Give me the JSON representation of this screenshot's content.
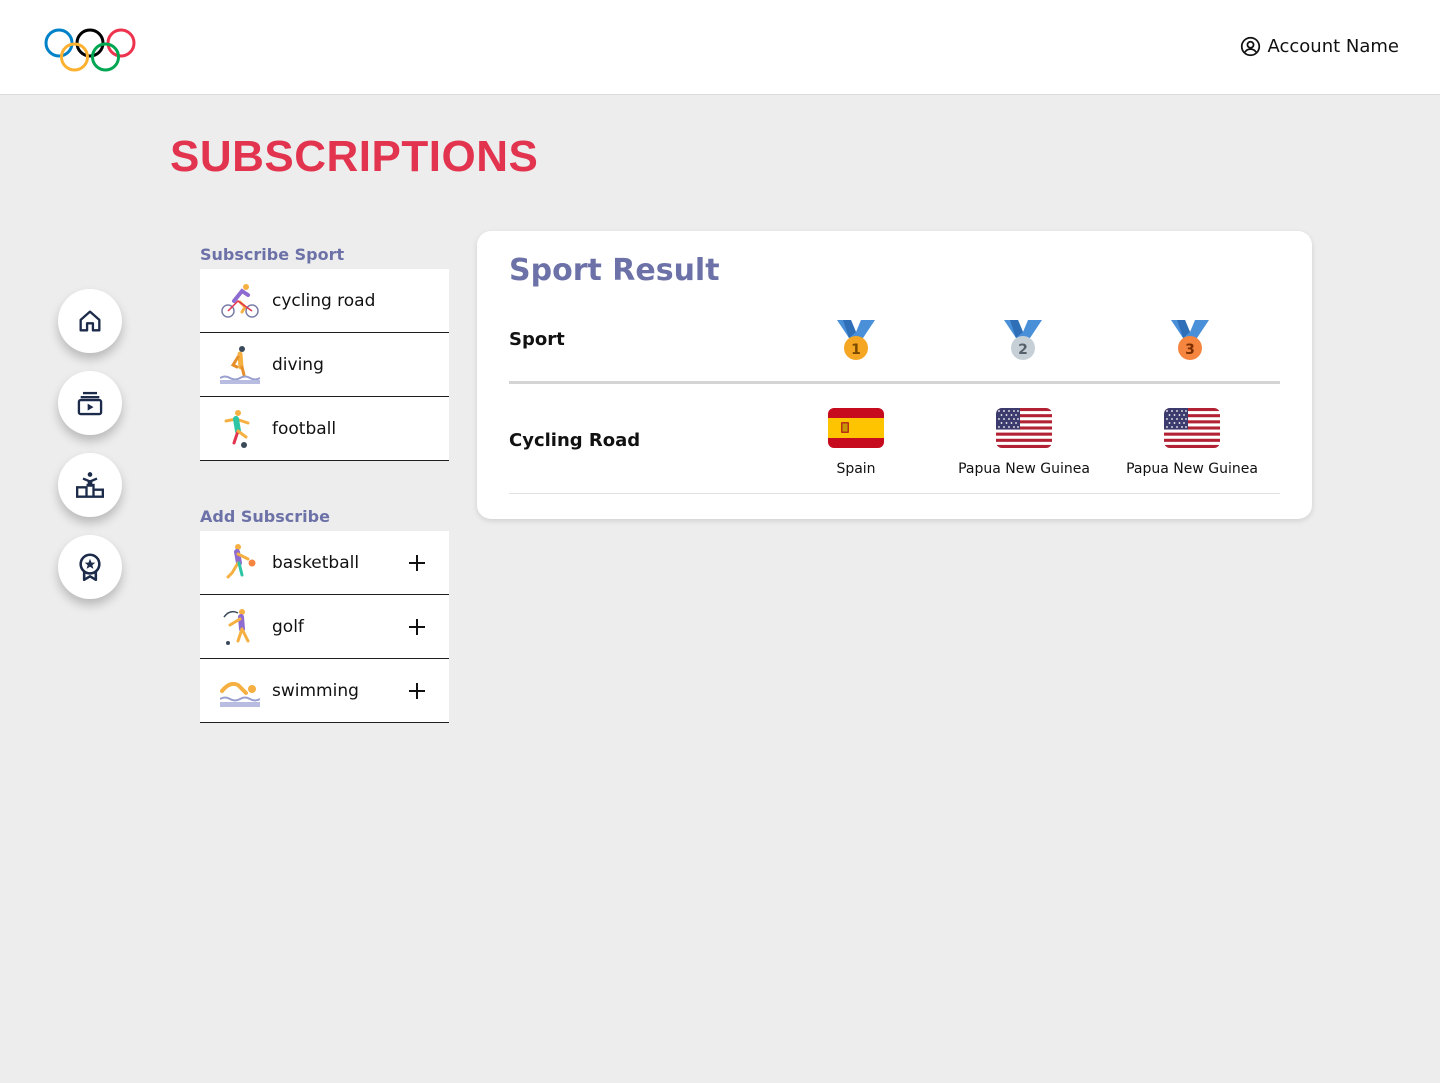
{
  "header": {
    "logo": "olympic-rings",
    "account": {
      "icon": "user-circle-icon",
      "label": "Account Name"
    }
  },
  "page": {
    "title": "SUBSCRIPTIONS"
  },
  "nav": [
    {
      "icon": "home-icon"
    },
    {
      "icon": "video-library-icon"
    },
    {
      "icon": "podium-icon"
    },
    {
      "icon": "medal-badge-icon"
    }
  ],
  "subscribed": {
    "label": "Subscribe Sport",
    "items": [
      {
        "name": "cycling road",
        "icon": "cycling-road-icon"
      },
      {
        "name": "diving",
        "icon": "diving-icon"
      },
      {
        "name": "football",
        "icon": "football-icon"
      }
    ]
  },
  "add": {
    "label": "Add Subscribe",
    "items": [
      {
        "name": "basketball",
        "icon": "basketball-icon"
      },
      {
        "name": "golf",
        "icon": "golf-icon"
      },
      {
        "name": "swimming",
        "icon": "swimming-icon"
      }
    ]
  },
  "result": {
    "title": "Sport Result",
    "header_label": "Sport",
    "medals": [
      {
        "rank": "1",
        "color": "#f5a623"
      },
      {
        "rank": "2",
        "color": "#c7cfd6"
      },
      {
        "rank": "3",
        "color": "#f5853f"
      }
    ],
    "rows": [
      {
        "sport": "Cycling Road",
        "places": [
          {
            "country": "Spain",
            "flag": "spain-flag"
          },
          {
            "country": "Papua New Guinea",
            "flag": "usa-flag"
          },
          {
            "country": "Papua New Guinea",
            "flag": "usa-flag"
          }
        ]
      }
    ]
  },
  "colors": {
    "accent_red": "#e2344f",
    "label_blue": "#6c72a8",
    "nav_navy": "#1c2b4a"
  }
}
